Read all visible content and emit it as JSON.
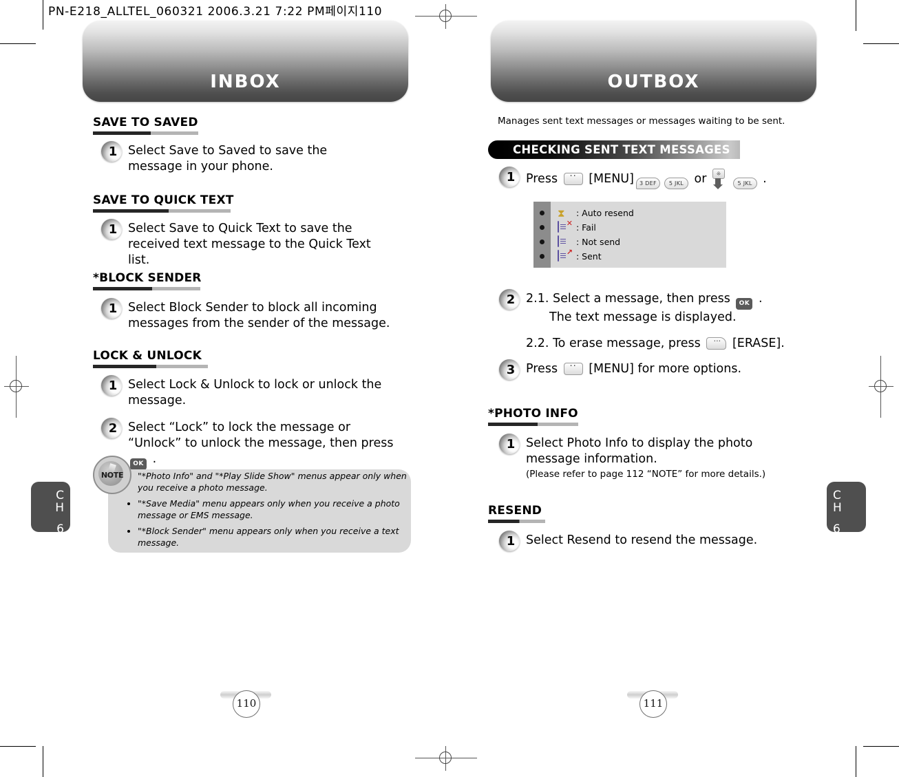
{
  "slug": {
    "text": "PN-E218_ALLTEL_060321  2006.3.21 7:22 PM페이지110"
  },
  "left_page": {
    "banner_title": "INBOX",
    "chapter_tab": {
      "ch": "C",
      "h": "H",
      "number": "6"
    },
    "page_number": "110",
    "sections": [
      {
        "heading": "SAVE TO SAVED",
        "steps": [
          {
            "num": "1",
            "text": "Select Save to Saved to save the message in your phone."
          }
        ]
      },
      {
        "heading": "SAVE TO QUICK TEXT",
        "steps": [
          {
            "num": "1",
            "text": "Select Save to Quick Text to save the received text message to the Quick Text list."
          }
        ]
      },
      {
        "heading": "*BLOCK SENDER",
        "steps": [
          {
            "num": "1",
            "text": "Select Block Sender to block all incoming messages from the sender of the message."
          }
        ]
      },
      {
        "heading": "LOCK & UNLOCK",
        "steps": [
          {
            "num": "1",
            "text": "Select Lock & Unlock to lock or unlock the message."
          },
          {
            "num": "2",
            "text_before": "Select “Lock” to lock the message or “Unlock” to unlock the message, then press",
            "key": "OK",
            "text_after": "."
          }
        ]
      }
    ],
    "note": {
      "icon_label": "NOTE",
      "items": [
        "\"*Photo Info\" and \"*Play Slide Show\" menus appear only when you receive a photo message.",
        "\"*Save Media\" menu appears only when you receive a photo message or EMS message.",
        "\"*Block Sender\" menu appears only when you receive a text message."
      ]
    }
  },
  "right_page": {
    "banner_title": "OUTBOX",
    "chapter_tab": {
      "ch": "C",
      "h": "H",
      "number": "6"
    },
    "page_number": "111",
    "intro": "Manages sent text messages or messages waiting to be sent.",
    "gradient_header": "CHECKING SENT TEXT MESSAGES",
    "step1": {
      "num": "1",
      "text_before": "Press",
      "key_menu": "[MENU]",
      "key_3": "3 DEF",
      "key_5a": "5 JKL",
      "text_or": "or",
      "key_5b": "5 JKL",
      "text_after": "."
    },
    "legend": [
      {
        "icon": "hourglass-icon",
        "glyph": "⧗",
        "label": ": Auto resend"
      },
      {
        "icon": "message-fail-icon",
        "glyph": "✕",
        "label": ": Fail",
        "mark_color": "#cc2222"
      },
      {
        "icon": "message-notsend-icon",
        "glyph": "",
        "label": ": Not send"
      },
      {
        "icon": "message-sent-icon",
        "glyph": "↗",
        "label": ": Sent",
        "mark_color": "#cc2222"
      }
    ],
    "step2": {
      "num": "2",
      "line1_before": "2.1. Select a message, then press",
      "line1_key": "OK",
      "line1_after": ".",
      "line1b": "The text message is displayed.",
      "line2_before": "2.2. To erase message, press",
      "line2_after": "[ERASE]."
    },
    "step3": {
      "num": "3",
      "text_before": "Press",
      "text_after": "[MENU] for more options."
    },
    "sections": [
      {
        "heading": "*PHOTO INFO",
        "steps": [
          {
            "num": "1",
            "text": "Select Photo Info to display the photo message information.",
            "sub": "(Please refer to page 112 “NOTE” for more details.)"
          }
        ]
      },
      {
        "heading": "RESEND",
        "steps": [
          {
            "num": "1",
            "text": "Select Resend to resend the message."
          }
        ]
      }
    ]
  }
}
